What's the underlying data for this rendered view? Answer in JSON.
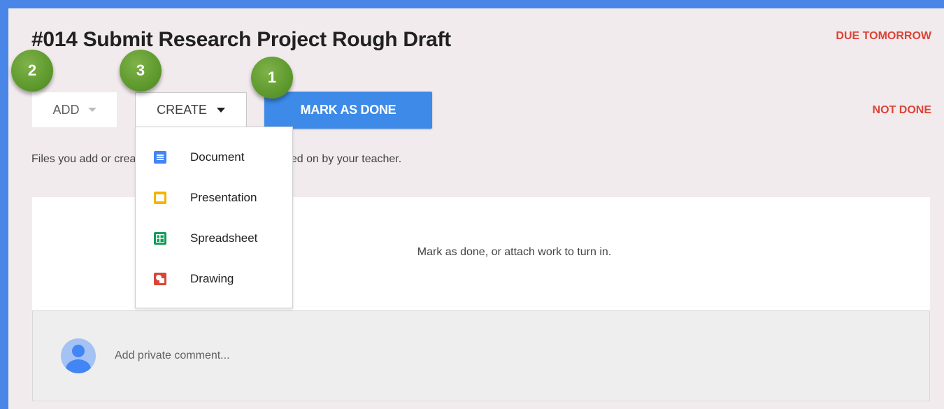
{
  "assignment": {
    "title": "#014 Submit Research Project Rough Draft",
    "due": "DUE TOMORROW",
    "status": "NOT DONE"
  },
  "actions": {
    "add_label": "ADD",
    "create_label": "CREATE",
    "mark_done_label": "MARK AS DONE"
  },
  "badges": [
    "2",
    "3",
    "1"
  ],
  "hint_text": "Files you add or create can be viewed and commented on by your teacher.",
  "create_menu": {
    "items": [
      {
        "label": "Document",
        "icon": "docs-icon"
      },
      {
        "label": "Presentation",
        "icon": "slides-icon"
      },
      {
        "label": "Spreadsheet",
        "icon": "sheets-icon"
      },
      {
        "label": "Drawing",
        "icon": "drawings-icon"
      }
    ]
  },
  "work_area": {
    "message": "Mark as done, or attach work to turn in."
  },
  "comment": {
    "placeholder": "Add private comment..."
  },
  "colors": {
    "frame": "#4a86e8",
    "primary_button": "#3d8ae8",
    "alert_red": "#db4437",
    "badge_green": "#5e9a2d"
  }
}
